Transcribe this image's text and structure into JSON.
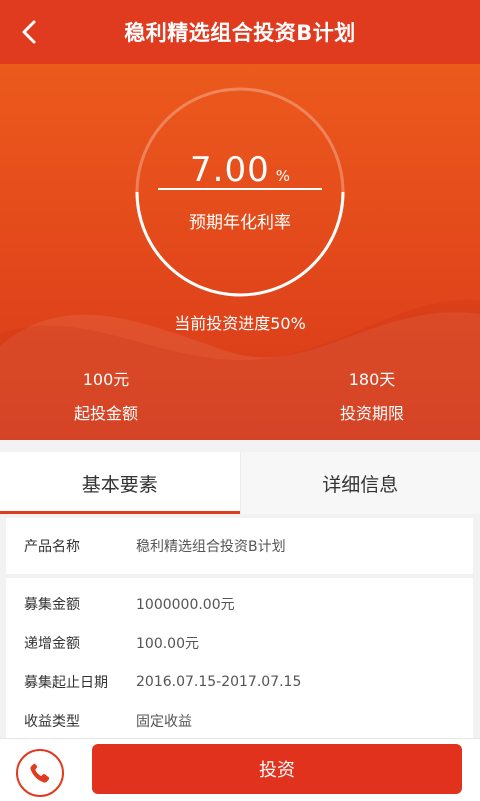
{
  "header": {
    "title": "稳利精选组合投资B计划"
  },
  "hero": {
    "rate_value": "7.00",
    "rate_unit": "%",
    "rate_label": "预期年化利率",
    "progress_text": "当前投资进度50%",
    "progress_fraction": 0.5,
    "min_amount_value": "100元",
    "min_amount_label": "起投金额",
    "term_value": "180天",
    "term_label": "投资期限"
  },
  "tabs": [
    {
      "label": "基本要素",
      "active": true
    },
    {
      "label": "详细信息",
      "active": false
    }
  ],
  "details": {
    "product_name": {
      "key": "产品名称",
      "value": "稳利精选组合投资B计划"
    },
    "rows": [
      {
        "key": "募集金额",
        "value": "1000000.00元"
      },
      {
        "key": "递增金额",
        "value": "100.00元"
      },
      {
        "key": "募集起止日期",
        "value": "2016.07.15-2017.07.15"
      },
      {
        "key": "收益类型",
        "value": "固定收益"
      }
    ]
  },
  "footer": {
    "invest_label": "投资"
  },
  "colors": {
    "brand": "#e03a1f",
    "hero_top": "#ec5a1c",
    "hero_bottom": "#d63a1a"
  },
  "icons": {
    "back": "chevron-left-icon",
    "phone": "phone-icon"
  }
}
